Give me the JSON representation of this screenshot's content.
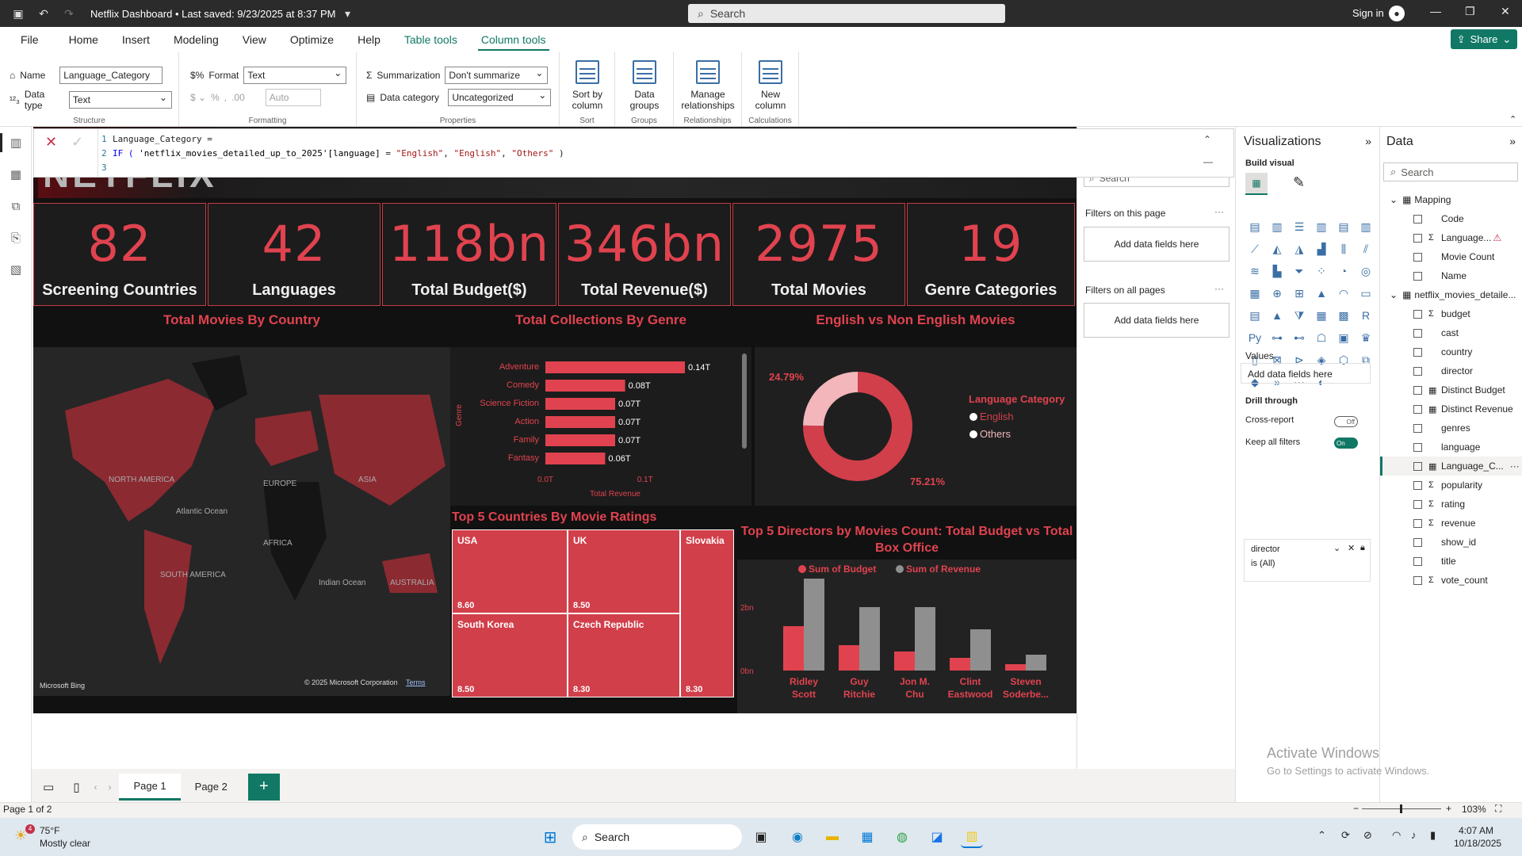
{
  "titlebar": {
    "doc_title": "Netflix Dashboard • Last saved: 9/23/2025 at 8:37 PM",
    "search_placeholder": "Search",
    "signin": "Sign in"
  },
  "menu": {
    "tabs": [
      "File",
      "Home",
      "Insert",
      "Modeling",
      "View",
      "Optimize",
      "Help",
      "Table tools",
      "Column tools"
    ],
    "share": "Share"
  },
  "ribbon": {
    "name_label": "Name",
    "name_value": "Language_Category",
    "datatype_label": "Data type",
    "datatype_value": "Text",
    "structure_label": "Structure",
    "format_label": "Format",
    "format_value": "Text",
    "auto_value": "Auto",
    "formatting_label": "Formatting",
    "summarization_label": "Summarization",
    "summarization_value": "Don't summarize",
    "datacategory_label": "Data category",
    "datacategory_value": "Uncategorized",
    "properties_label": "Properties",
    "sort_by_column": "Sort by column",
    "sort_label": "Sort",
    "data_groups": "Data groups",
    "groups_label": "Groups",
    "manage_relationships": "Manage relationships",
    "relationships_label": "Relationships",
    "new_column": "New column",
    "calculations_label": "Calculations"
  },
  "formula": {
    "line1": "Language_Category =",
    "line2_a": "IF ( ",
    "line2_table": "'netflix_movies_detailed_up_to_2025'[language]",
    "line2_b": " = ",
    "line2_s1": "\"English\"",
    "line2_s2": "\"English\"",
    "line2_s3": "\"Others\"",
    "line2_c": " )",
    "ln1": "1",
    "ln2": "2",
    "ln3": "3"
  },
  "report": {
    "logo": "NETFLIX",
    "kpis": [
      {
        "value": "82",
        "label": "Screening Countries"
      },
      {
        "value": "42",
        "label": "Languages"
      },
      {
        "value": "118bn",
        "label": "Total Budget($)"
      },
      {
        "value": "346bn",
        "label": "Total Revenue($)"
      },
      {
        "value": "2975",
        "label": "Total Movies"
      },
      {
        "value": "19",
        "label": "Genre Categories"
      }
    ],
    "map_title": "Total Movies By Country",
    "map_labels": {
      "na": "NORTH AMERICA",
      "eu": "EUROPE",
      "asia": "ASIA",
      "atl": "Atlantic Ocean",
      "af": "AFRICA",
      "sa": "SOUTH AMERICA",
      "ind": "Indian Ocean",
      "au": "AUSTRALIA"
    },
    "map_credit_left": "Microsoft Bing",
    "map_credit_right": "© 2025 Microsoft Corporation",
    "map_terms": "Terms",
    "genre_title": "Total Collections By Genre",
    "donut_title": "English vs Non English Movies",
    "treemap_title": "Top 5 Countries By Movie Ratings",
    "combo_title": "Top 5 Directors by Movies Count: Total Budget vs Total Box Office"
  },
  "chart_data": [
    {
      "type": "bar",
      "title": "Total Collections By Genre",
      "ylabel": "Genre",
      "xlabel": "Total Revenue",
      "categories": [
        "Adventure",
        "Comedy",
        "Science Fiction",
        "Action",
        "Family",
        "Fantasy"
      ],
      "values": [
        0.14,
        0.08,
        0.07,
        0.07,
        0.07,
        0.06
      ],
      "data_labels": [
        "0.14T",
        "0.08T",
        "0.07T",
        "0.07T",
        "0.07T",
        "0.06T"
      ],
      "x_ticks": [
        "0.0T",
        "0.1T"
      ],
      "xlim": [
        0,
        0.14
      ]
    },
    {
      "type": "pie",
      "title": "English vs Non English Movies",
      "legend_title": "Language Category",
      "categories": [
        "English",
        "Others"
      ],
      "values": [
        75.21,
        24.79
      ],
      "data_labels": [
        "75.21%",
        "24.79%"
      ],
      "colors": [
        "#d13f4a",
        "#f2b6bb"
      ]
    },
    {
      "type": "table",
      "title": "Top 5 Countries By Movie Ratings",
      "categories": [
        "USA",
        "UK",
        "Slovakia",
        "South Korea",
        "Czech Republic"
      ],
      "values": [
        8.6,
        8.5,
        8.3,
        8.5,
        8.3
      ],
      "data_labels": [
        "8.60",
        "8.50",
        "8.30",
        "8.50",
        "8.30"
      ]
    },
    {
      "type": "bar",
      "title": "Top 5 Directors by Movies Count: Total Budget vs Total Box Office",
      "categories": [
        "Ridley Scott",
        "Guy Ritchie",
        "Jon M. Chu",
        "Clint Eastwood",
        "Steven Soderbe..."
      ],
      "category_lines": [
        [
          "Ridley",
          "Scott"
        ],
        [
          "Guy",
          "Ritchie"
        ],
        [
          "Jon M.",
          "Chu"
        ],
        [
          "Clint",
          "Eastwood"
        ],
        [
          "Steven",
          "Soderbe..."
        ]
      ],
      "series": [
        {
          "name": "Sum of Budget",
          "values": [
            1.4,
            0.8,
            0.6,
            0.4,
            0.2
          ]
        },
        {
          "name": "Sum of Revenue",
          "values": [
            2.9,
            2.0,
            2.0,
            1.3,
            0.5
          ]
        }
      ],
      "y_ticks": [
        "0bn",
        "2bn"
      ],
      "ylim": [
        0,
        3
      ],
      "colors": [
        "#e0434f",
        "#8f8f8f"
      ]
    }
  ],
  "filters": {
    "search_placeholder": "Search",
    "on_this_page": "Filters on this page",
    "on_all_pages": "Filters on all pages",
    "add_fields": "Add data fields here"
  },
  "viz": {
    "title": "Visualizations",
    "build_visual": "Build visual",
    "values_label": "Values",
    "add_fields": "Add data fields here",
    "drill_through": "Drill through",
    "cross_report": "Cross-report",
    "cross_report_state": "Off",
    "keep_all_filters": "Keep all filters",
    "keep_all_state": "On",
    "filter_field": "director",
    "filter_value": "is (All)"
  },
  "data": {
    "title": "Data",
    "search_placeholder": "Search",
    "tables": [
      {
        "name": "Mapping",
        "fields": [
          {
            "name": "Code",
            "type": ""
          },
          {
            "name": "Language...",
            "type": "sigma",
            "warn": true
          },
          {
            "name": "Movie Count",
            "type": ""
          },
          {
            "name": "Name",
            "type": ""
          }
        ]
      },
      {
        "name": "netflix_movies_detaile...",
        "fields": [
          {
            "name": "budget",
            "type": "sigma"
          },
          {
            "name": "cast",
            "type": ""
          },
          {
            "name": "country",
            "type": ""
          },
          {
            "name": "director",
            "type": ""
          },
          {
            "name": "Distinct Budget",
            "type": "calc"
          },
          {
            "name": "Distinct Revenue",
            "type": "calc"
          },
          {
            "name": "genres",
            "type": ""
          },
          {
            "name": "language",
            "type": ""
          },
          {
            "name": "Language_C...",
            "type": "calc",
            "selected": true
          },
          {
            "name": "popularity",
            "type": "sigma"
          },
          {
            "name": "rating",
            "type": "sigma"
          },
          {
            "name": "revenue",
            "type": "sigma"
          },
          {
            "name": "show_id",
            "type": ""
          },
          {
            "name": "title",
            "type": ""
          },
          {
            "name": "vote_count",
            "type": "sigma"
          }
        ]
      }
    ]
  },
  "pages": {
    "tabs": [
      "Page 1",
      "Page 2"
    ],
    "add": "+"
  },
  "status": {
    "page_info": "Page 1 of 2",
    "zoom": "103%"
  },
  "watermark": {
    "line1": "Activate Windows",
    "line2": "Go to Settings to activate Windows."
  },
  "taskbar": {
    "weather_temp": "75°F",
    "weather_desc": "Mostly clear",
    "weather_badge": "4",
    "search_placeholder": "Search",
    "time": "4:07 AM",
    "date": "10/18/2025"
  }
}
